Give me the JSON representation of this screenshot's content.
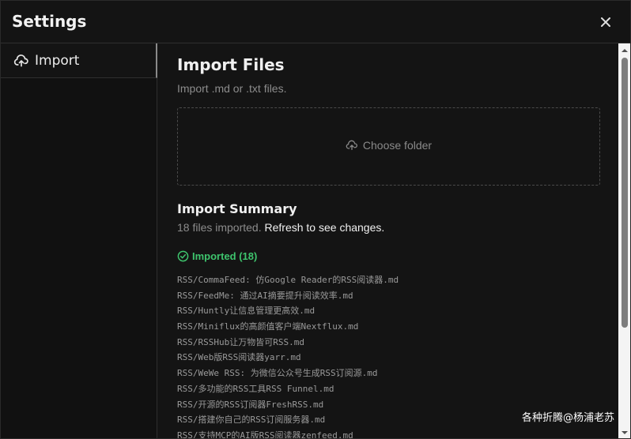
{
  "header": {
    "title": "Settings",
    "close_icon": "close-icon"
  },
  "sidebar": {
    "items": [
      {
        "label": "Import",
        "icon": "cloud-upload-icon",
        "active": true
      }
    ]
  },
  "main": {
    "title": "Import Files",
    "subtitle": "Import .md or .txt files.",
    "dropzone": {
      "label": "Choose folder",
      "icon": "cloud-upload-icon"
    },
    "summary": {
      "title": "Import Summary",
      "count_text": "18 files imported.",
      "refresh_text": "Refresh to see changes."
    },
    "imported": {
      "label": "Imported (18)",
      "icon": "check-circle-icon",
      "color": "#3ec46d",
      "files": [
        "RSS/CommaFeed: 仿Google Reader的RSS阅读器.md",
        "RSS/FeedMe: 通过AI摘要提升阅读效率.md",
        "RSS/Huntly让信息管理更高效.md",
        "RSS/Miniflux的高颜值客户端Nextflux.md",
        "RSS/RSSHub让万物皆可RSS.md",
        "RSS/Web版RSS阅读器yarr.md",
        "RSS/WeWe RSS: 为微信公众号生成RSS订阅源.md",
        "RSS/多功能的RSS工具RSS Funnel.md",
        "RSS/开源的RSS订阅器FreshRSS.md",
        "RSS/搭建你自己的RSS订阅服务器.md",
        "RSS/支持MCP的AI版RSS阅读器zenfeed.md"
      ]
    }
  },
  "watermark": "各种折腾@杨浦老苏"
}
